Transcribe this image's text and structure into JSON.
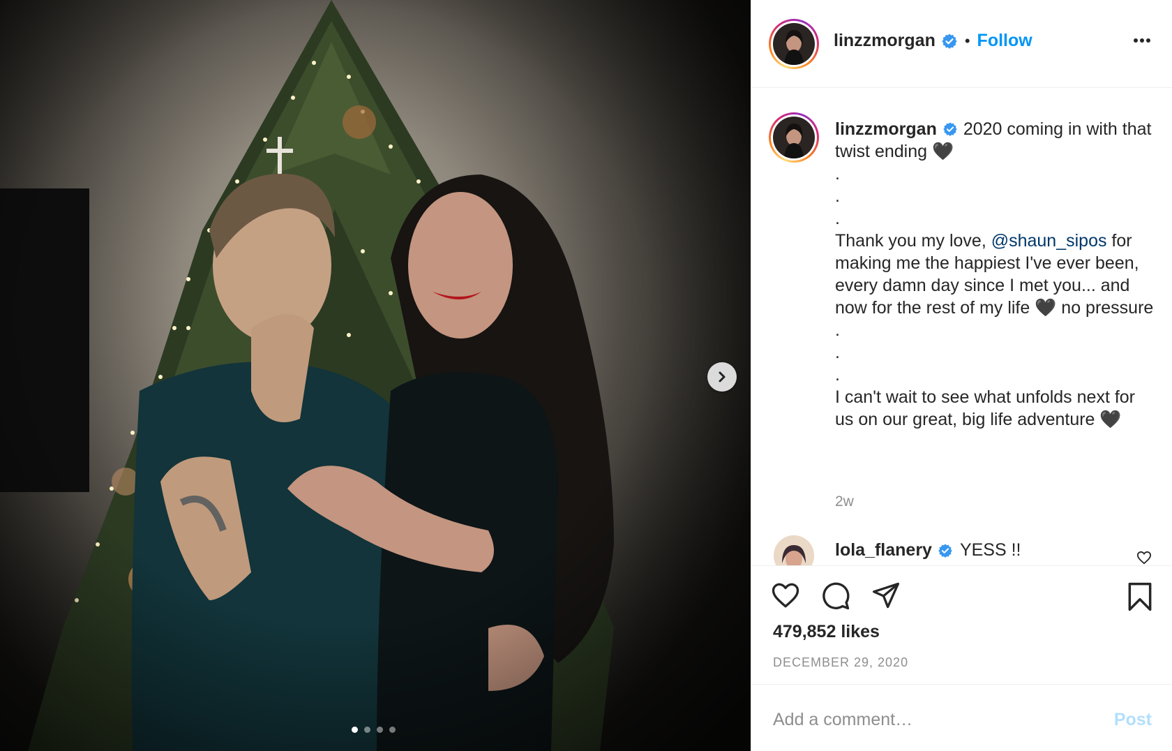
{
  "post": {
    "author": "linzzmorgan",
    "follow_label": "Follow",
    "separator": "•",
    "caption": {
      "username": "linzzmorgan",
      "text": "2020 coming in with that twist ending 🖤\n.\n.\n.\n",
      "text_before_mention": "Thank you my love, ",
      "mention": "@shaun_sipos",
      "text_after_mention": " for making me the happiest I've ever been, every damn day since I met you... and now for the rest of my life 🖤 no pressure\n.\n.\n.\nI can't wait to see what unfolds next for us on our great, big life adventure 🖤",
      "age": "2w"
    },
    "comments": [
      {
        "username": "lola_flanery",
        "text": "YESS !!"
      }
    ],
    "likes_text": "479,852 likes",
    "date": "DECEMBER 29, 2020",
    "add_comment_placeholder": "Add a comment…",
    "post_label": "Post",
    "carousel": {
      "total": 4,
      "active": 1
    }
  },
  "icons": {
    "verified": "verified-badge-icon",
    "more": "more-options-icon",
    "like": "heart-icon",
    "comment": "comment-icon",
    "share": "paper-plane-icon",
    "save": "bookmark-icon",
    "next": "chevron-right-icon"
  },
  "colors": {
    "link": "#0095f6",
    "mention": "#00376b",
    "muted": "#8e8e8e",
    "post_disabled": "#b2dffc",
    "verified": "#3897f0"
  }
}
